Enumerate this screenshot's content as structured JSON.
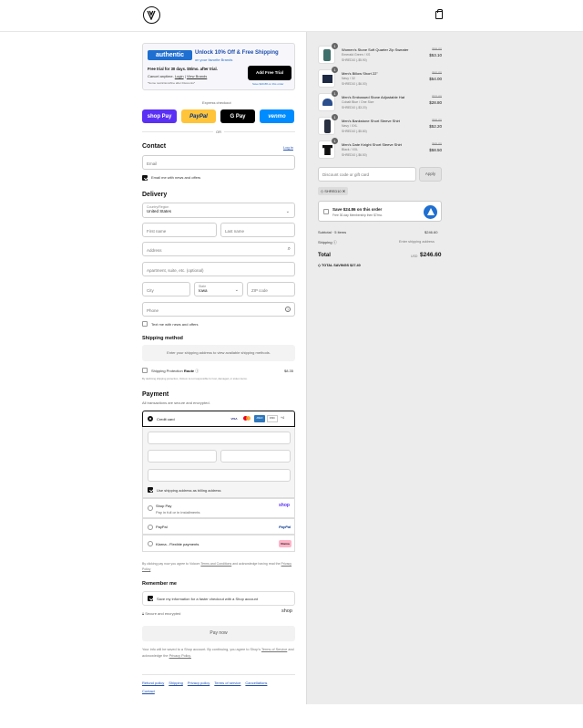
{
  "header": {
    "logo": "volcom-stone-logo",
    "bag_icon": "shopping-bag-icon"
  },
  "promo": {
    "brand": "authentic",
    "title": "Unlock 10% Off & Free Shipping",
    "subtitle": "on your favorite Brands",
    "trial_line": "Free trial for 30 days. $5/mo. after trial.",
    "cancel_prefix": "Cancel anytime.",
    "login": "Login",
    "sep": " | ",
    "view_brands": "View Brands",
    "fine_print": "*Some restrictions/fine after Discounts*",
    "cta": "Add Free Trial",
    "cta_sub": "Save $20.88 on this order"
  },
  "express": {
    "label": "Express checkout",
    "or": "OR",
    "buttons": [
      {
        "label": "shop Pay",
        "color": "#5a31f4"
      },
      {
        "label": "PayPal",
        "color": "#ffc439"
      },
      {
        "label": "G Pay",
        "color": "#000000"
      },
      {
        "label": "venmo",
        "color": "#008cff"
      }
    ]
  },
  "contact": {
    "title": "Contact",
    "login": "Log in",
    "email_placeholder": "Email",
    "news_label": "Email me with news and offers"
  },
  "delivery": {
    "title": "Delivery",
    "country_label": "Country/Region",
    "country": "United States",
    "first": "First name",
    "last": "Last name",
    "address": "Address",
    "apt": "Apartment, suite, etc. (optional)",
    "city": "City",
    "state_label": "State",
    "state": "Iowa",
    "zip": "ZIP code",
    "phone": "Phone",
    "text_label": "Text me with news and offers"
  },
  "shipping": {
    "title": "Shipping method",
    "placeholder": "Enter your shipping address to view available shipping methods.",
    "protection": "Shipping Protection",
    "route": "Route",
    "price": "$8.35",
    "fine": "By declining shipping protection, Volcom is not responsible for lost, damaged, or stolen items."
  },
  "payment": {
    "title": "Payment",
    "subtitle": "All transactions are secure and encrypted.",
    "credit": "Credit card",
    "cards": [
      "VISA",
      "MC",
      "AMEX",
      "DISC",
      "+4"
    ],
    "billing_label": "Use shipping address as billing address",
    "shop_pay": "Shop Pay",
    "shop_pay_sub": "Pay in full or in installments",
    "shop_logo": "shop",
    "paypal": "PayPal",
    "paypal_logo": "PayPal",
    "klarna": "Klarna - Flexible payments",
    "klarna_logo": "Klarna"
  },
  "terms": {
    "prefix": "By clicking pay now you agree to Volcom",
    "tc": "Terms and Conditions",
    "mid": "and acknowledge having read the",
    "pp": "Privacy Policy"
  },
  "remember": {
    "title": "Remember me",
    "label": "Save my information for a faster checkout with a Shop account",
    "secure": "Secure and encrypted",
    "shop": "shop"
  },
  "pay_now": "Pay now",
  "shop_note": {
    "prefix": "Your info will be saved to a Shop account. By continuing, you agree to Shop's",
    "tos": "Terms of Service",
    "mid": "and acknowledge the",
    "pp": "Privacy Policy."
  },
  "footer": {
    "links": [
      "Refund policy",
      "Shipping",
      "Privacy policy",
      "Terms of service",
      "Cancellations",
      "Contact"
    ]
  },
  "cart": {
    "items": [
      {
        "name": "Women's Stone Soft Quarter Zip Sweater",
        "variant": "Emerald Green / XS",
        "discount": "SHRED10 (-$5.90)",
        "old": "$59.00",
        "price": "$53.10",
        "qty": "1",
        "color": "#3f6f6a"
      },
      {
        "name": "Men's Billow Short 22\"",
        "variant": "Navy / 32",
        "discount": "SHRED10 (-$6.00)",
        "old": "$60.00",
        "price": "$54.00",
        "qty": "1",
        "color": "#1e2a44"
      },
      {
        "name": "Men's Embossed Stone Adjustable Hat",
        "variant": "Cobalt Blue / One Size",
        "discount": "SHRED10 (-$3.20)",
        "old": "$32.00",
        "price": "$28.80",
        "qty": "1",
        "color": "#2b4f8c"
      },
      {
        "name": "Men's Bankstone Short Sleeve Shirt",
        "variant": "Navy / XXL",
        "discount": "SHRED10 (-$5.80)",
        "old": "$58.00",
        "price": "$52.20",
        "qty": "1",
        "color": "#2a3140"
      },
      {
        "name": "Men's Date Knight Short Sleeve Shirt",
        "variant": "Black / XXL",
        "discount": "SHRED10 (-$6.50)",
        "old": "$65.00",
        "price": "$58.50",
        "qty": "1",
        "color": "#111111"
      }
    ],
    "discount_placeholder": "Discount code or gift card",
    "apply": "Apply",
    "code": "SHRED10",
    "membership_title": "Save $24.86 on this order",
    "membership_sub": "Free 30-day Membership then $7/mo.",
    "subtotal_label": "Subtotal · 5 items",
    "subtotal": "$246.60",
    "shipping_label": "Shipping",
    "shipping_value": "Enter shipping address",
    "total_label": "Total",
    "currency": "USD",
    "total": "$246.60",
    "savings_label": "TOTAL SAVINGS",
    "savings": "$27.40"
  }
}
